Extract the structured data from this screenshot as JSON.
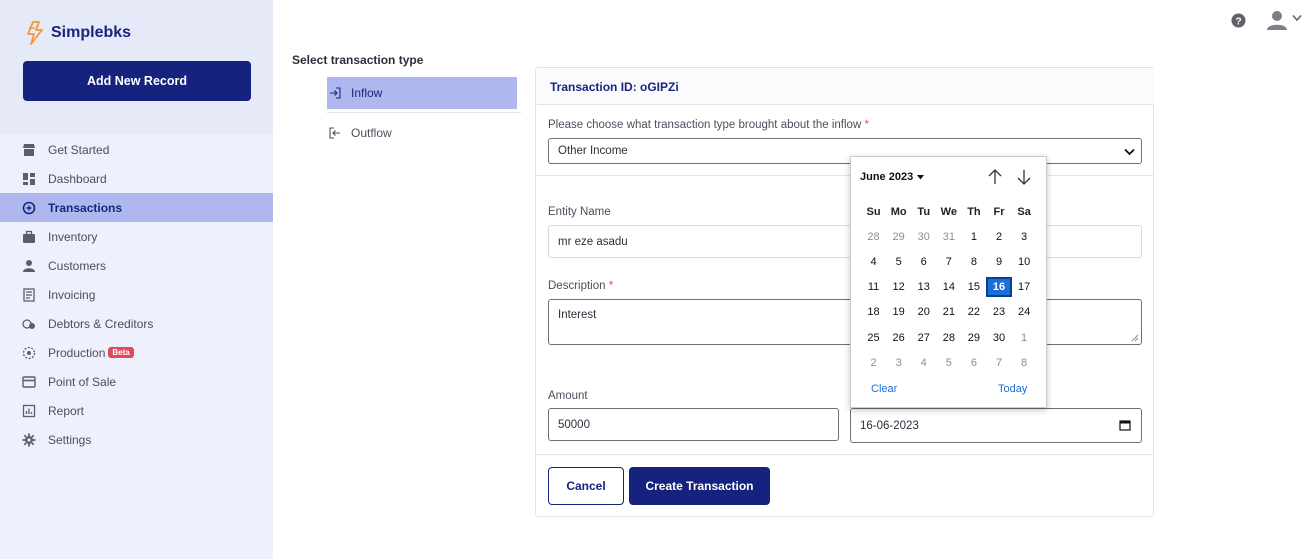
{
  "app": {
    "name": "Simplebks"
  },
  "sidebar": {
    "add_button": "Add New Record",
    "items": [
      {
        "label": "Get Started",
        "icon": "store-icon"
      },
      {
        "label": "Dashboard",
        "icon": "dashboard-icon"
      },
      {
        "label": "Transactions",
        "icon": "transactions-icon",
        "active": true
      },
      {
        "label": "Inventory",
        "icon": "briefcase-icon"
      },
      {
        "label": "Customers",
        "icon": "person-icon"
      },
      {
        "label": "Invoicing",
        "icon": "invoice-icon"
      },
      {
        "label": "Debtors & Creditors",
        "icon": "debtors-icon"
      },
      {
        "label": "Production",
        "icon": "production-icon",
        "badge": "Beta"
      },
      {
        "label": "Point of Sale",
        "icon": "card-icon"
      },
      {
        "label": "Report",
        "icon": "report-icon"
      },
      {
        "label": "Settings",
        "icon": "gear-icon"
      }
    ]
  },
  "header": {
    "help_icon": "help-icon",
    "user_icon": "user-icon"
  },
  "type_selector": {
    "label": "Select transaction type",
    "options": [
      {
        "label": "Inflow",
        "icon": "sign-in-icon",
        "active": true
      },
      {
        "label": "Outflow",
        "icon": "sign-out-icon"
      }
    ]
  },
  "form": {
    "transaction_id": "Transaction ID: oGIPZi",
    "type_question": "Please choose what transaction type brought about the inflow",
    "required_mark": "*",
    "type_value": "Other Income",
    "entity_label": "Entity Name",
    "entity_value": "mr eze asadu",
    "description_label": "Description",
    "description_value": "Interest",
    "amount_label": "Amount",
    "amount_value": "50000",
    "date_value": "16-06-2023",
    "cancel_label": "Cancel",
    "create_label": "Create Transaction"
  },
  "datepicker": {
    "month_label": "June 2023",
    "weekdays": [
      "Su",
      "Mo",
      "Tu",
      "We",
      "Th",
      "Fr",
      "Sa"
    ],
    "weeks": [
      [
        {
          "d": "28",
          "m": true
        },
        {
          "d": "29",
          "m": true
        },
        {
          "d": "30",
          "m": true
        },
        {
          "d": "31",
          "m": true
        },
        {
          "d": "1"
        },
        {
          "d": "2"
        },
        {
          "d": "3"
        }
      ],
      [
        {
          "d": "4"
        },
        {
          "d": "5"
        },
        {
          "d": "6"
        },
        {
          "d": "7"
        },
        {
          "d": "8"
        },
        {
          "d": "9"
        },
        {
          "d": "10"
        }
      ],
      [
        {
          "d": "11"
        },
        {
          "d": "12"
        },
        {
          "d": "13"
        },
        {
          "d": "14"
        },
        {
          "d": "15"
        },
        {
          "d": "16",
          "s": true
        },
        {
          "d": "17"
        }
      ],
      [
        {
          "d": "18"
        },
        {
          "d": "19"
        },
        {
          "d": "20"
        },
        {
          "d": "21"
        },
        {
          "d": "22"
        },
        {
          "d": "23"
        },
        {
          "d": "24"
        }
      ],
      [
        {
          "d": "25"
        },
        {
          "d": "26"
        },
        {
          "d": "27"
        },
        {
          "d": "28"
        },
        {
          "d": "29"
        },
        {
          "d": "30"
        },
        {
          "d": "1",
          "m": true
        }
      ],
      [
        {
          "d": "2",
          "m": true
        },
        {
          "d": "3",
          "m": true
        },
        {
          "d": "4",
          "m": true
        },
        {
          "d": "5",
          "m": true
        },
        {
          "d": "6",
          "m": true
        },
        {
          "d": "7",
          "m": true
        },
        {
          "d": "8",
          "m": true
        }
      ]
    ],
    "clear_label": "Clear",
    "today_label": "Today"
  },
  "colors": {
    "primary": "#16237e",
    "active_bg": "#aeb8ef",
    "sidebar_bg": "#eef0fb",
    "selected_day": "#1a6ed8",
    "required": "#e2495f"
  }
}
